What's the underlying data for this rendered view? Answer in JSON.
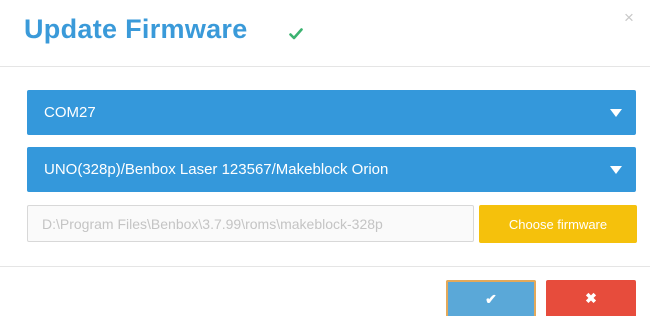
{
  "dialog": {
    "title": "Update Firmware",
    "title_icon": "check-icon",
    "close_icon": "close-icon",
    "close_glyph": "×"
  },
  "port_select": {
    "value": "COM27",
    "icon": "chevron-down-icon"
  },
  "board_select": {
    "value": "UNO(328p)/Benbox Laser 123567/Makeblock Orion",
    "icon": "chevron-down-icon"
  },
  "firmware_path": {
    "value": "D:\\Program Files\\Benbox\\3.7.99\\roms\\makeblock-328p"
  },
  "choose_button": {
    "label": "Choose firmware"
  },
  "footer": {
    "ok_icon": "check-icon",
    "ok_glyph": "✔",
    "cancel_icon": "close-icon",
    "cancel_glyph": "✖"
  },
  "colors": {
    "title": "#3a9ad9",
    "select_bg": "#3498db",
    "choose_bg": "#f5c10c",
    "ok_bg": "#5aa8d8",
    "cancel_bg": "#e74c3c",
    "check_green": "#3cb371"
  }
}
